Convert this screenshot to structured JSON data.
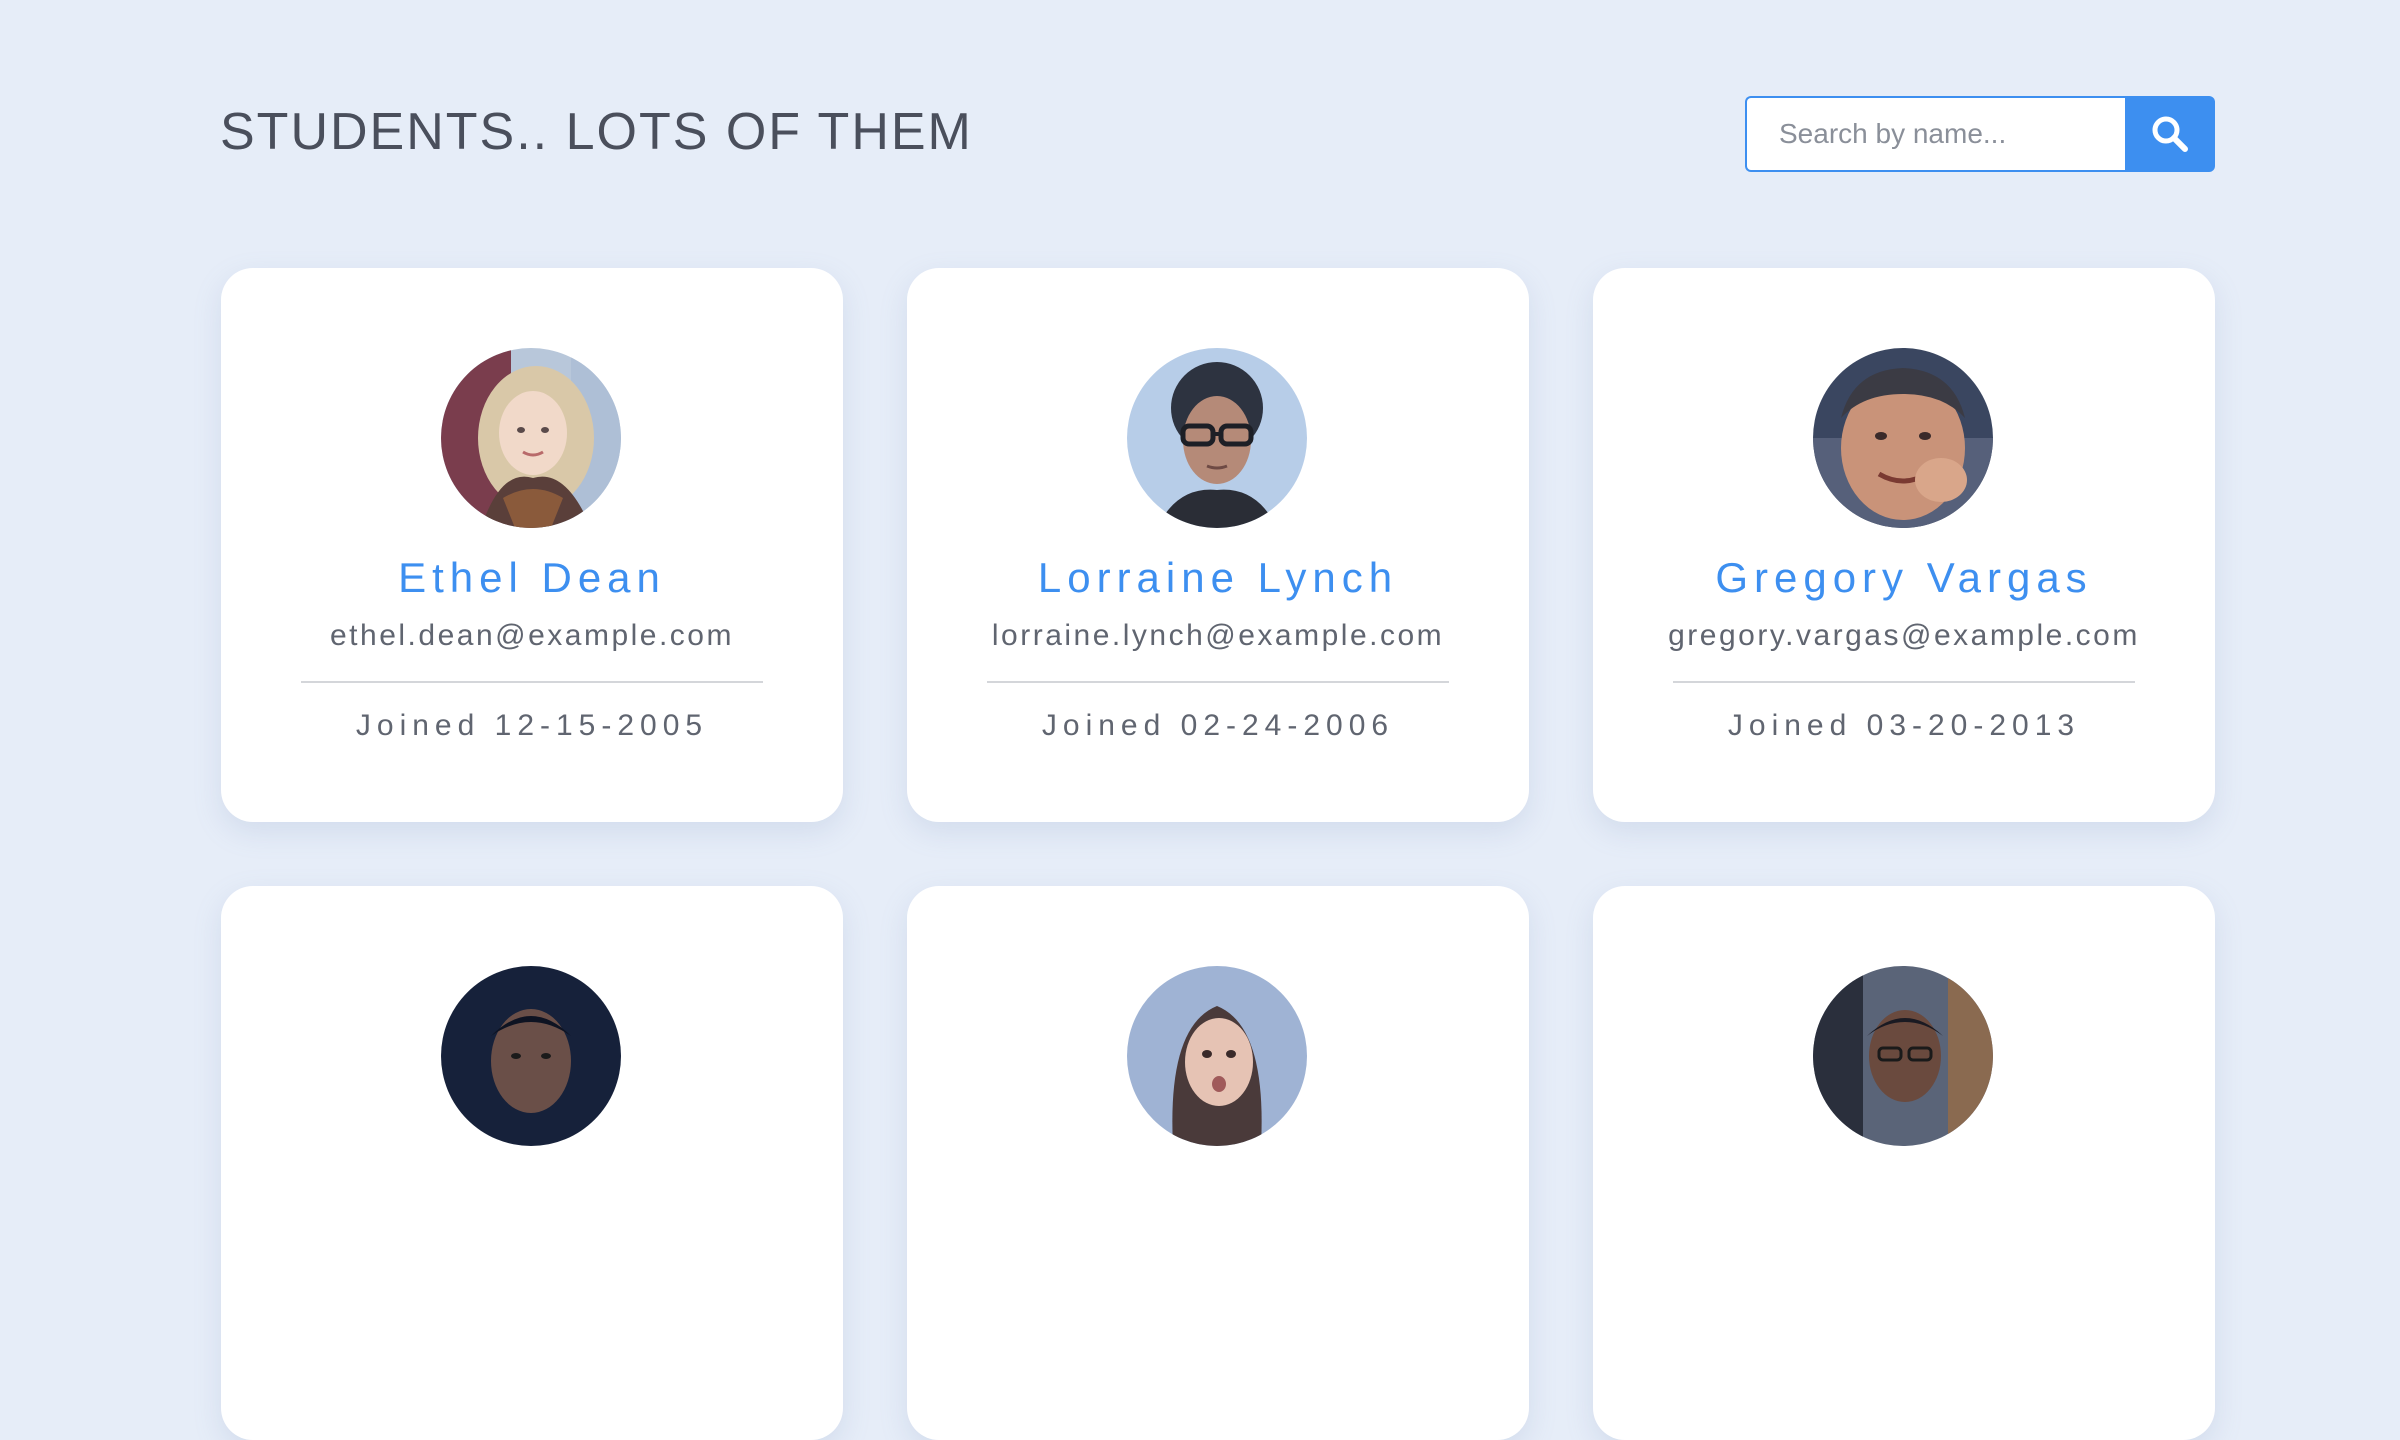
{
  "header": {
    "title": "STUDENTS.. LOTS OF THEM"
  },
  "search": {
    "placeholder": "Search by name...",
    "value": "",
    "button_icon": "search-icon"
  },
  "colors": {
    "background": "#e6edf8",
    "accent": "#3d8ff0",
    "card": "#ffffff",
    "text": "#4a4f5c"
  },
  "students": [
    {
      "name": "Ethel Dean",
      "email": "ethel.dean@example.com",
      "joined": "Joined 12-15-2005",
      "avatar_icon": "avatar-photo"
    },
    {
      "name": "Lorraine Lynch",
      "email": "lorraine.lynch@example.com",
      "joined": "Joined 02-24-2006",
      "avatar_icon": "avatar-photo"
    },
    {
      "name": "Gregory Vargas",
      "email": "gregory.vargas@example.com",
      "joined": "Joined 03-20-2013",
      "avatar_icon": "avatar-photo"
    },
    {
      "avatar_icon": "avatar-photo"
    },
    {
      "avatar_icon": "avatar-photo"
    },
    {
      "avatar_icon": "avatar-photo"
    }
  ]
}
